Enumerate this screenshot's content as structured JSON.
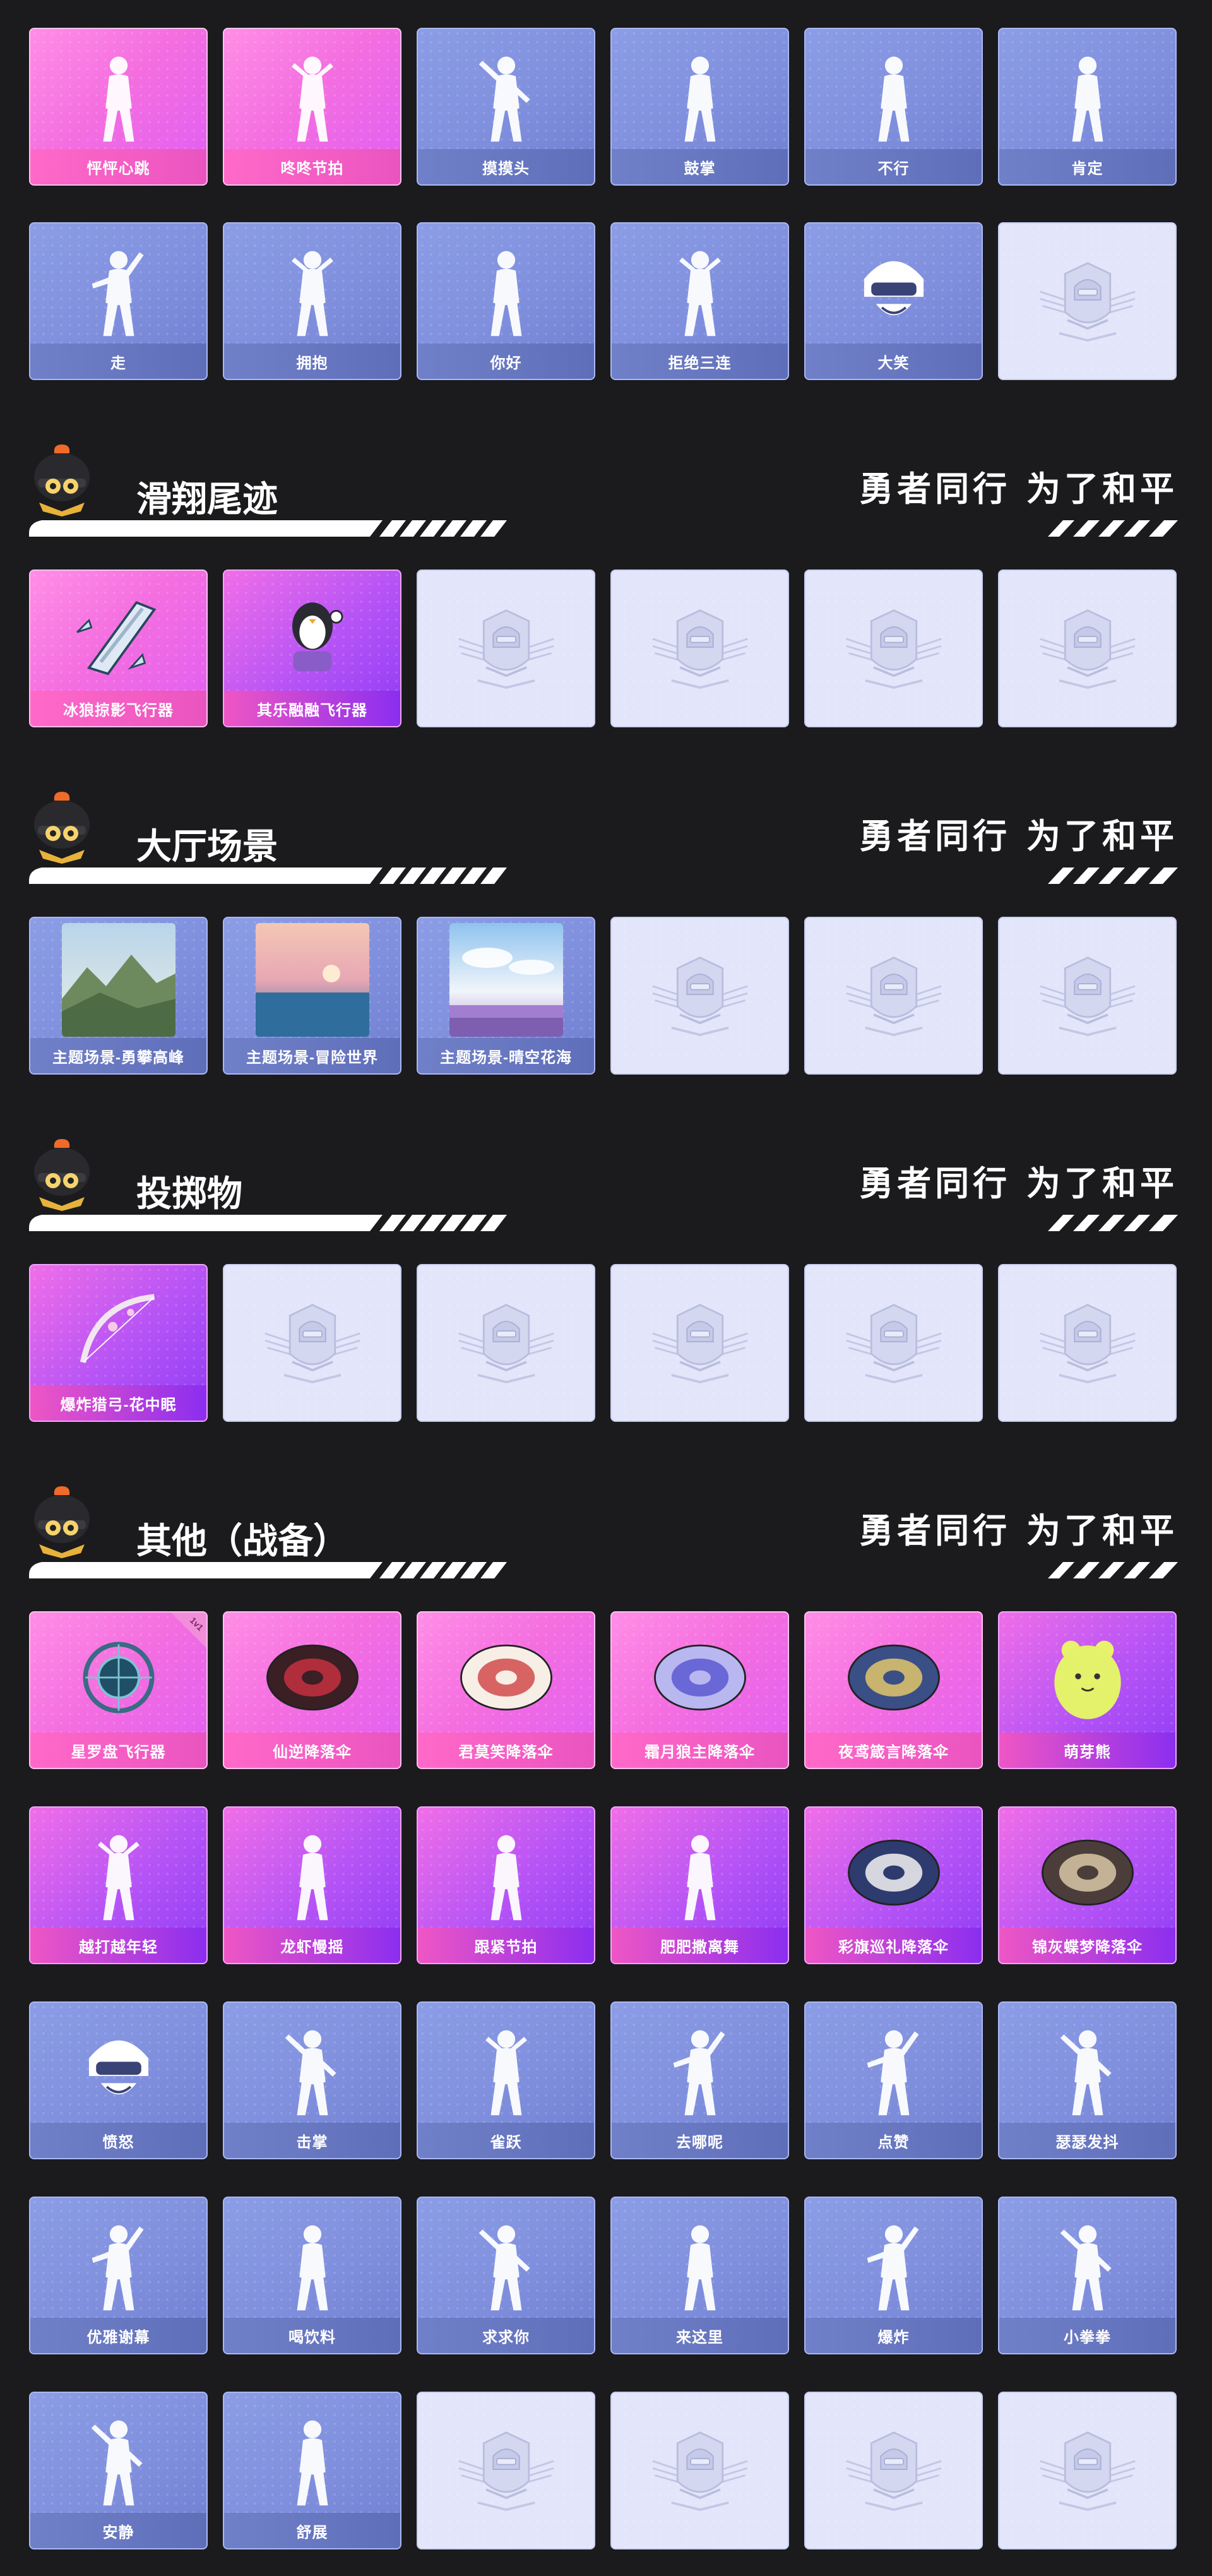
{
  "sections": [
    {
      "title": "",
      "slogan": "",
      "items": [
        {
          "label": "怦怦心跳",
          "style": "pink",
          "icon": "emote-heartbeat-dance-icon"
        },
        {
          "label": "咚咚节拍",
          "style": "pink",
          "icon": "emote-beat-dance-icon"
        },
        {
          "label": "摸摸头",
          "style": "blue",
          "icon": "emote-pat-head-icon"
        },
        {
          "label": "鼓掌",
          "style": "blue",
          "icon": "emote-clap-icon"
        },
        {
          "label": "不行",
          "style": "blue",
          "icon": "emote-no-icon"
        },
        {
          "label": "肯定",
          "style": "blue",
          "icon": "emote-nod-icon"
        },
        {
          "label": "走",
          "style": "blue",
          "icon": "emote-point-go-icon"
        },
        {
          "label": "拥抱",
          "style": "blue",
          "icon": "emote-hug-icon"
        },
        {
          "label": "你好",
          "style": "blue",
          "icon": "emote-wave-icon"
        },
        {
          "label": "拒绝三连",
          "style": "blue",
          "icon": "emote-cross-arms-icon"
        },
        {
          "label": "大笑",
          "style": "blue",
          "icon": "emote-laugh-helmet-icon"
        },
        {
          "label": "",
          "style": "empty",
          "icon": "locked-emblem-icon"
        }
      ]
    },
    {
      "title": "滑翔尾迹",
      "slogan": "勇者同行 为了和平",
      "items": [
        {
          "label": "冰狼掠影飞行器",
          "style": "pink",
          "icon": "ice-wolf-glider-icon"
        },
        {
          "label": "其乐融融飞行器",
          "style": "violet",
          "icon": "penguin-glider-icon"
        },
        {
          "label": "",
          "style": "empty",
          "icon": "locked-emblem-icon"
        },
        {
          "label": "",
          "style": "empty",
          "icon": "locked-emblem-icon"
        },
        {
          "label": "",
          "style": "empty",
          "icon": "locked-emblem-icon"
        },
        {
          "label": "",
          "style": "empty",
          "icon": "locked-emblem-icon"
        }
      ]
    },
    {
      "title": "大厅场景",
      "slogan": "勇者同行 为了和平",
      "items": [
        {
          "label": "主题场景-勇攀高峰",
          "style": "blue",
          "icon": "scene-mountain-thumbnail"
        },
        {
          "label": "主题场景-冒险世界",
          "style": "blue",
          "icon": "scene-sea-thumbnail"
        },
        {
          "label": "主题场景-晴空花海",
          "style": "blue",
          "icon": "scene-flower-field-thumbnail"
        },
        {
          "label": "",
          "style": "empty",
          "icon": "locked-emblem-icon"
        },
        {
          "label": "",
          "style": "empty",
          "icon": "locked-emblem-icon"
        },
        {
          "label": "",
          "style": "empty",
          "icon": "locked-emblem-icon"
        }
      ]
    },
    {
      "title": "投掷物",
      "slogan": "勇者同行 为了和平",
      "items": [
        {
          "label": "爆炸猎弓-花中眠",
          "style": "violet",
          "icon": "bow-weapon-icon"
        },
        {
          "label": "",
          "style": "empty",
          "icon": "locked-emblem-icon"
        },
        {
          "label": "",
          "style": "empty",
          "icon": "locked-emblem-icon"
        },
        {
          "label": "",
          "style": "empty",
          "icon": "locked-emblem-icon"
        },
        {
          "label": "",
          "style": "empty",
          "icon": "locked-emblem-icon"
        },
        {
          "label": "",
          "style": "empty",
          "icon": "locked-emblem-icon"
        }
      ]
    },
    {
      "title": "其他（战备）",
      "slogan": "勇者同行 为了和平",
      "items": [
        {
          "label": "星罗盘飞行器",
          "style": "pink",
          "icon": "astrolabe-glider-icon",
          "badge": "1v1"
        },
        {
          "label": "仙逆降落伞",
          "style": "pink",
          "icon": "parachute-red-icon"
        },
        {
          "label": "君莫笑降落伞",
          "style": "pink",
          "icon": "parachute-white-red-icon"
        },
        {
          "label": "霜月狼主降落伞",
          "style": "pink",
          "icon": "parachute-frost-wolf-icon"
        },
        {
          "label": "夜鸢箴言降落伞",
          "style": "pink",
          "icon": "parachute-blue-gold-icon"
        },
        {
          "label": "萌芽熊",
          "style": "violet",
          "icon": "sprout-bear-icon"
        },
        {
          "label": "越打越年轻",
          "style": "violet",
          "icon": "emote-dance-young-icon"
        },
        {
          "label": "龙虾慢摇",
          "style": "violet",
          "icon": "emote-lobster-sway-icon"
        },
        {
          "label": "跟紧节拍",
          "style": "violet",
          "icon": "emote-follow-beat-icon"
        },
        {
          "label": "肥肥撒离舞",
          "style": "violet",
          "icon": "emote-sun-hat-dance-icon"
        },
        {
          "label": "彩旗巡礼降落伞",
          "style": "violet",
          "icon": "parachute-flag-icon"
        },
        {
          "label": "锦灰蝶梦降落伞",
          "style": "violet",
          "icon": "parachute-butterfly-icon"
        },
        {
          "label": "愤怒",
          "style": "blue",
          "icon": "emote-angry-icon"
        },
        {
          "label": "击掌",
          "style": "blue",
          "icon": "emote-high-five-icon"
        },
        {
          "label": "雀跃",
          "style": "blue",
          "icon": "emote-jump-icon"
        },
        {
          "label": "去哪呢",
          "style": "blue",
          "icon": "emote-shrug-icon"
        },
        {
          "label": "点赞",
          "style": "blue",
          "icon": "emote-thumbs-up-icon"
        },
        {
          "label": "瑟瑟发抖",
          "style": "blue",
          "icon": "emote-shiver-icon"
        },
        {
          "label": "优雅谢幕",
          "style": "blue",
          "icon": "emote-bow-icon"
        },
        {
          "label": "喝饮料",
          "style": "blue",
          "icon": "emote-drink-icon"
        },
        {
          "label": "求求你",
          "style": "blue",
          "icon": "emote-beg-icon"
        },
        {
          "label": "来这里",
          "style": "blue",
          "icon": "emote-come-here-icon"
        },
        {
          "label": "爆炸",
          "style": "blue",
          "icon": "emote-explode-icon"
        },
        {
          "label": "小拳拳",
          "style": "blue",
          "icon": "emote-little-fist-icon"
        },
        {
          "label": "安静",
          "style": "blue",
          "icon": "emote-quiet-icon"
        },
        {
          "label": "舒展",
          "style": "blue",
          "icon": "emote-stretch-icon"
        },
        {
          "label": "",
          "style": "empty",
          "icon": "locked-emblem-icon"
        },
        {
          "label": "",
          "style": "empty",
          "icon": "locked-emblem-icon"
        },
        {
          "label": "",
          "style": "empty",
          "icon": "locked-emblem-icon"
        },
        {
          "label": "",
          "style": "empty",
          "icon": "locked-emblem-icon"
        }
      ]
    }
  ]
}
